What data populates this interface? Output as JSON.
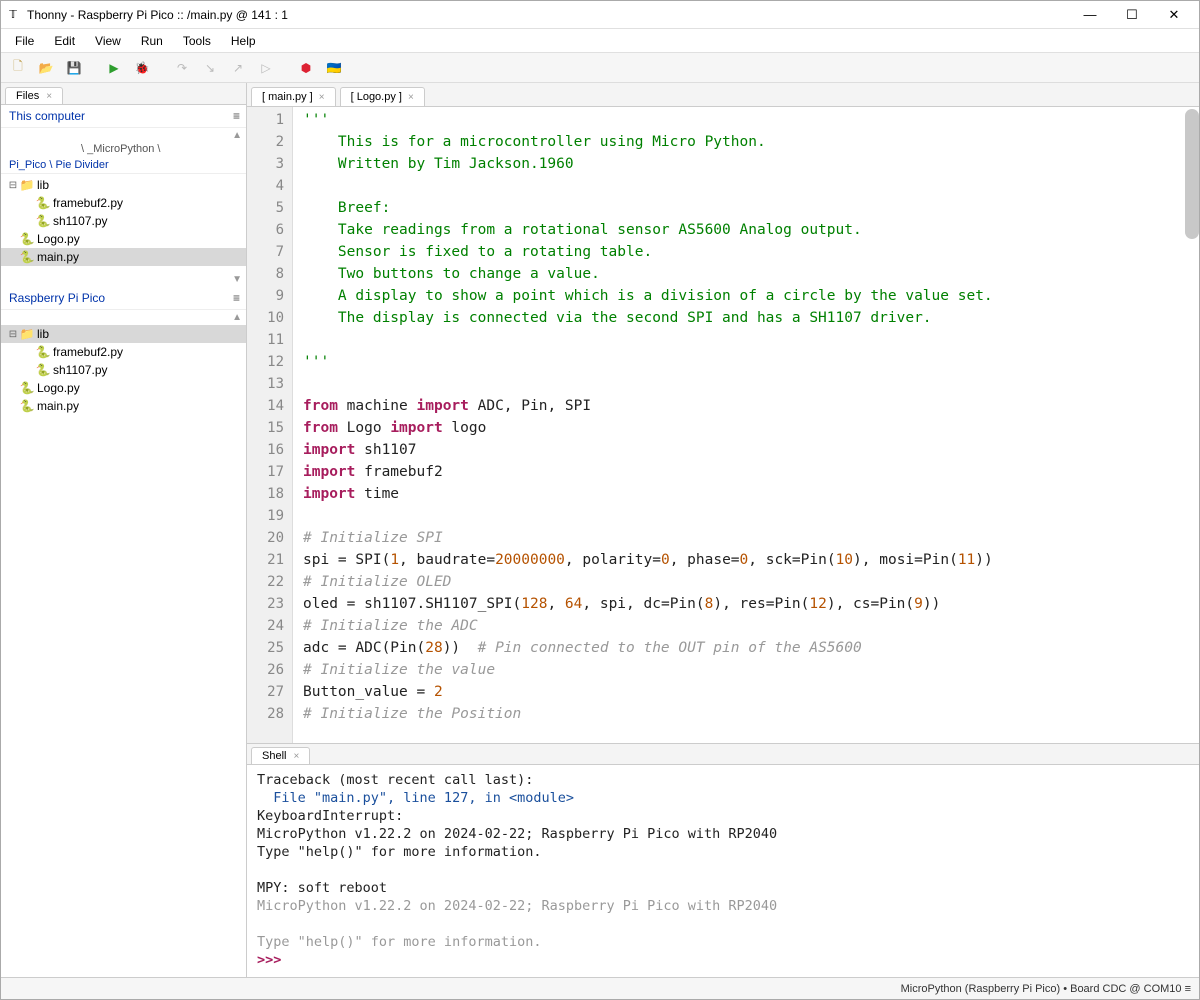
{
  "window": {
    "title": "Thonny  -  Raspberry Pi Pico :: /main.py  @  141 : 1"
  },
  "menu": [
    "File",
    "Edit",
    "View",
    "Run",
    "Tools",
    "Help"
  ],
  "toolbar_icons": [
    {
      "name": "new-file-icon",
      "glyph": "🗋",
      "color": "#c0a050"
    },
    {
      "name": "open-file-icon",
      "glyph": "📂",
      "color": "#e6a43a"
    },
    {
      "name": "save-file-icon",
      "glyph": "💾",
      "color": "#b0b0b0"
    },
    {
      "name": "sep"
    },
    {
      "name": "run-icon",
      "glyph": "▶",
      "color": "#2e9e2e"
    },
    {
      "name": "debug-icon",
      "glyph": "🐞",
      "color": "#bbb"
    },
    {
      "name": "sep"
    },
    {
      "name": "step-over-icon",
      "glyph": "↷",
      "color": "#bbb"
    },
    {
      "name": "step-into-icon",
      "glyph": "↘",
      "color": "#bbb"
    },
    {
      "name": "step-out-icon",
      "glyph": "↗",
      "color": "#bbb"
    },
    {
      "name": "resume-icon",
      "glyph": "▷",
      "color": "#bbb"
    },
    {
      "name": "sep"
    },
    {
      "name": "stop-icon",
      "glyph": "⬢",
      "color": "#d23"
    },
    {
      "name": "ukraine-flag-icon",
      "glyph": "🇺🇦",
      "color": ""
    }
  ],
  "files_panel": {
    "tab_label": "Files",
    "local_header": "This computer",
    "local_path": "\\ _MicroPython \\",
    "local_sub": "Pi_Pico \\ Pie Divider",
    "local_tree": [
      {
        "type": "folder",
        "label": "lib",
        "children": [
          {
            "type": "py",
            "label": "framebuf2.py"
          },
          {
            "type": "py",
            "label": "sh1107.py"
          }
        ]
      },
      {
        "type": "py",
        "label": "Logo.py"
      },
      {
        "type": "py",
        "label": "main.py",
        "selected": true
      }
    ],
    "device_header": "Raspberry Pi Pico",
    "device_tree": [
      {
        "type": "folder",
        "label": "lib",
        "selected": true,
        "children": [
          {
            "type": "py",
            "label": "framebuf2.py"
          },
          {
            "type": "py",
            "label": "sh1107.py"
          }
        ]
      },
      {
        "type": "py",
        "label": "Logo.py"
      },
      {
        "type": "py",
        "label": "main.py"
      }
    ]
  },
  "editor_tabs": [
    {
      "label": "[ main.py ]",
      "active": true
    },
    {
      "label": "[ Logo.py ]",
      "active": false
    }
  ],
  "code_lines": [
    {
      "n": 1,
      "html": "<span class='str'>'''</span>"
    },
    {
      "n": 2,
      "html": "<span class='str'>    This is for a microcontroller using Micro Python.</span>"
    },
    {
      "n": 3,
      "html": "<span class='str'>    Written by Tim Jackson.1960</span>"
    },
    {
      "n": 4,
      "html": ""
    },
    {
      "n": 5,
      "html": "<span class='str'>    Breef:</span>"
    },
    {
      "n": 6,
      "html": "<span class='str'>    Take readings from a rotational sensor AS5600 Analog output.</span>"
    },
    {
      "n": 7,
      "html": "<span class='str'>    Sensor is fixed to a rotating table.</span>"
    },
    {
      "n": 8,
      "html": "<span class='str'>    Two buttons to change a value.</span>"
    },
    {
      "n": 9,
      "html": "<span class='str'>    A display to show a point which is a division of a circle by the value set.</span>"
    },
    {
      "n": 10,
      "html": "<span class='str'>    The display is connected via the second SPI and has a SH1107 driver.</span>"
    },
    {
      "n": 11,
      "html": ""
    },
    {
      "n": 12,
      "html": "<span class='str'>'''</span>"
    },
    {
      "n": 13,
      "html": ""
    },
    {
      "n": 14,
      "html": "<span class='kw'>from</span> machine <span class='kw'>import</span> ADC, Pin, SPI"
    },
    {
      "n": 15,
      "html": "<span class='kw'>from</span> Logo <span class='kw'>import</span> logo"
    },
    {
      "n": 16,
      "html": "<span class='kw'>import</span> sh1107"
    },
    {
      "n": 17,
      "html": "<span class='kw'>import</span> framebuf2"
    },
    {
      "n": 18,
      "html": "<span class='kw'>import</span> time"
    },
    {
      "n": 19,
      "html": ""
    },
    {
      "n": 20,
      "html": "<span class='com'># Initialize SPI</span>"
    },
    {
      "n": 21,
      "html": "spi = SPI(<span class='num'>1</span>, baudrate=<span class='num'>20000000</span>, polarity=<span class='num'>0</span>, phase=<span class='num'>0</span>, sck=Pin(<span class='num'>10</span>), mosi=Pin(<span class='num'>11</span>))"
    },
    {
      "n": 22,
      "html": "<span class='com'># Initialize OLED</span>"
    },
    {
      "n": 23,
      "html": "oled = sh1107.SH1107_SPI(<span class='num'>128</span>, <span class='num'>64</span>, spi, dc=Pin(<span class='num'>8</span>), res=Pin(<span class='num'>12</span>), cs=Pin(<span class='num'>9</span>))"
    },
    {
      "n": 24,
      "html": "<span class='com'># Initialize the ADC</span>"
    },
    {
      "n": 25,
      "html": "adc = ADC(Pin(<span class='num'>28</span>))  <span class='com'># Pin connected to the OUT pin of the AS5600</span>"
    },
    {
      "n": 26,
      "html": "<span class='com'># Initialize the value</span>"
    },
    {
      "n": 27,
      "html": "Button_value = <span class='num'>2</span>"
    },
    {
      "n": 28,
      "html": "<span class='com'># Initialize the Position</span>"
    }
  ],
  "shell": {
    "tab_label": "Shell",
    "lines": [
      {
        "cls": "",
        "text": "Traceback (most recent call last):"
      },
      {
        "cls": "shell-link",
        "text": "  File \"main.py\", line 127, in <module>"
      },
      {
        "cls": "",
        "text": "KeyboardInterrupt: "
      },
      {
        "cls": "",
        "text": "MicroPython v1.22.2 on 2024-02-22; Raspberry Pi Pico with RP2040"
      },
      {
        "cls": "",
        "text": "Type \"help()\" for more information."
      },
      {
        "cls": "",
        "text": ""
      },
      {
        "cls": "",
        "text": "MPY: soft reboot"
      },
      {
        "cls": "shell-dim",
        "text": "MicroPython v1.22.2 on 2024-02-22; Raspberry Pi Pico with RP2040"
      },
      {
        "cls": "shell-dim",
        "text": ""
      },
      {
        "cls": "shell-dim",
        "text": "Type \"help()\" for more information."
      }
    ],
    "prompt": ">>> "
  },
  "status": {
    "right": "MicroPython (Raspberry Pi Pico)  •  Board CDC @ COM10 ≡"
  }
}
